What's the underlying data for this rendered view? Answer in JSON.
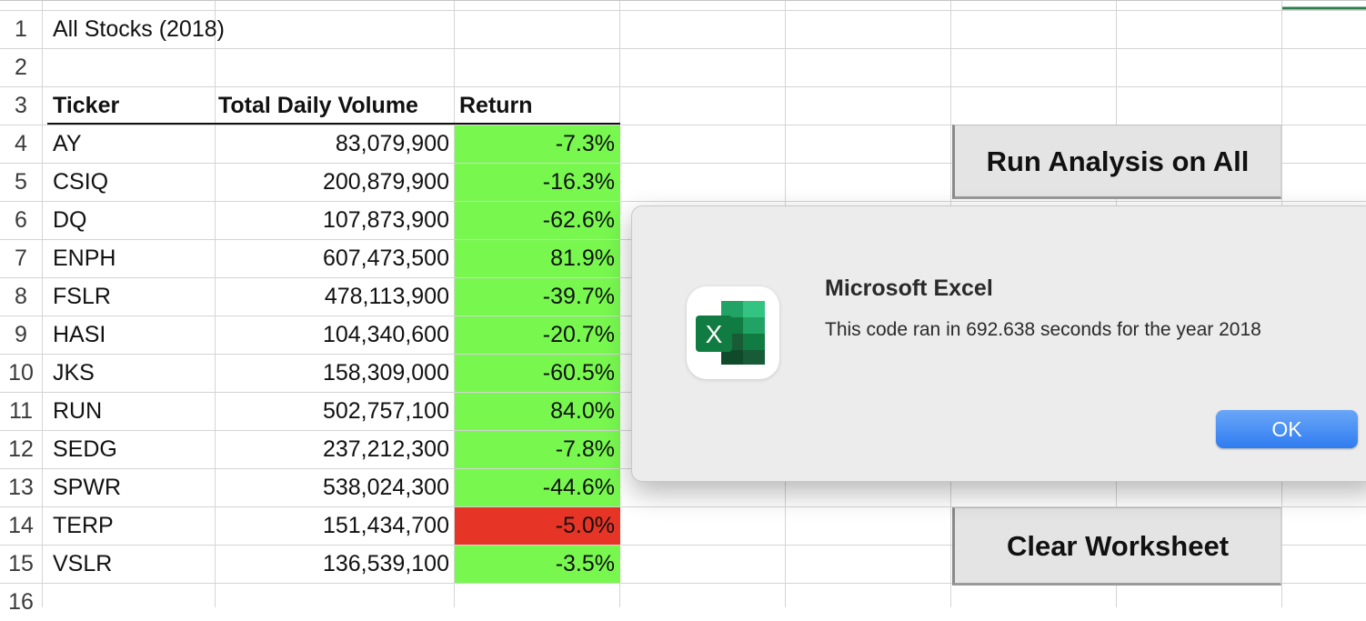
{
  "sheet": {
    "row_numbers": [
      "1",
      "2",
      "3",
      "4",
      "5",
      "6",
      "7",
      "8",
      "9",
      "10",
      "11",
      "12",
      "13",
      "14",
      "15",
      "16"
    ],
    "title": "All Stocks (2018)",
    "headers": {
      "ticker": "Ticker",
      "volume": "Total Daily Volume",
      "return": "Return"
    },
    "rows": [
      {
        "ticker": "AY",
        "volume": "83,079,900",
        "return": "-7.3%",
        "fill": "#78f84f"
      },
      {
        "ticker": "CSIQ",
        "volume": "200,879,900",
        "return": "-16.3%",
        "fill": "#78f84f"
      },
      {
        "ticker": "DQ",
        "volume": "107,873,900",
        "return": "-62.6%",
        "fill": "#78f84f"
      },
      {
        "ticker": "ENPH",
        "volume": "607,473,500",
        "return": "81.9%",
        "fill": "#78f84f"
      },
      {
        "ticker": "FSLR",
        "volume": "478,113,900",
        "return": "-39.7%",
        "fill": "#78f84f"
      },
      {
        "ticker": "HASI",
        "volume": "104,340,600",
        "return": "-20.7%",
        "fill": "#78f84f"
      },
      {
        "ticker": "JKS",
        "volume": "158,309,000",
        "return": "-60.5%",
        "fill": "#78f84f"
      },
      {
        "ticker": "RUN",
        "volume": "502,757,100",
        "return": "84.0%",
        "fill": "#78f84f"
      },
      {
        "ticker": "SEDG",
        "volume": "237,212,300",
        "return": "-7.8%",
        "fill": "#78f84f"
      },
      {
        "ticker": "SPWR",
        "volume": "538,024,300",
        "return": "-44.6%",
        "fill": "#78f84f"
      },
      {
        "ticker": "TERP",
        "volume": "151,434,700",
        "return": "-5.0%",
        "fill": "#e63426"
      },
      {
        "ticker": "VSLR",
        "volume": "136,539,100",
        "return": "-3.5%",
        "fill": "#78f84f"
      }
    ]
  },
  "buttons": {
    "run_all": "Run Analysis on All",
    "clear": "Clear Worksheet"
  },
  "dialog": {
    "title": "Microsoft Excel",
    "message": "This code ran in 692.638 seconds for the year 2018",
    "ok_label": "OK",
    "icon": "excel-icon"
  },
  "colors": {
    "positive_fill": "#78f84f",
    "negative_fill": "#e63426",
    "gridline": "#d4d4d4",
    "ok_blue": "#2f7df0",
    "excel_green": "#1f7244"
  }
}
